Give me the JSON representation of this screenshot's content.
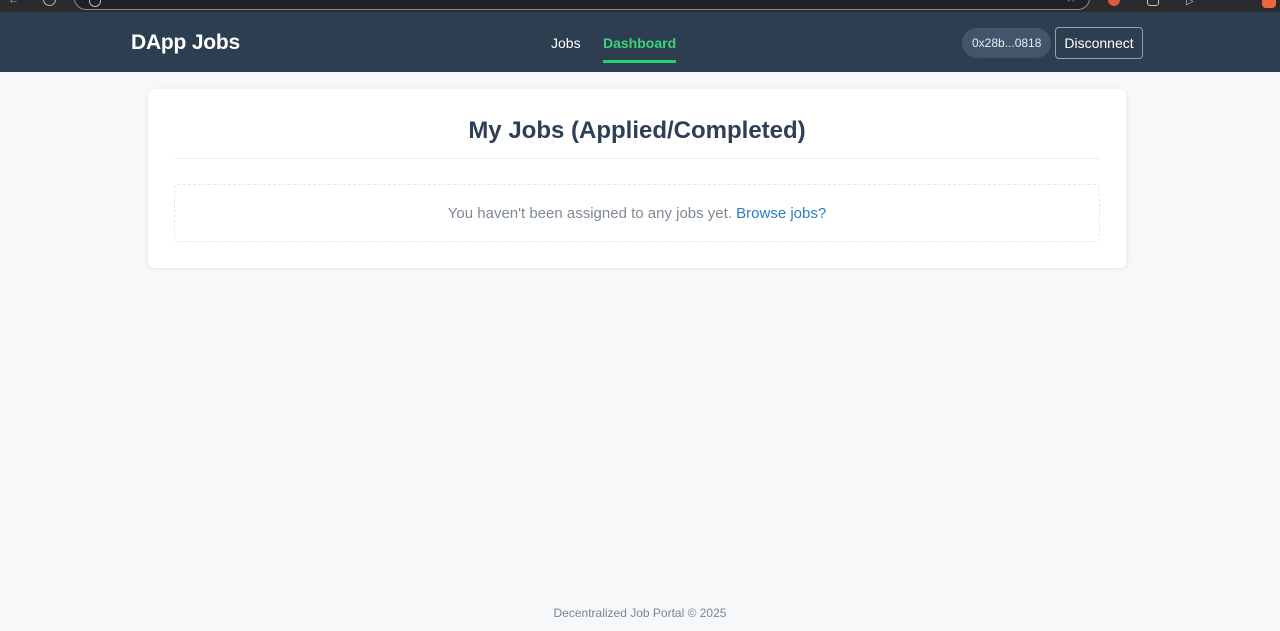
{
  "browser": {
    "icons": [
      "back-icon",
      "reload-icon",
      "info-icon",
      "star-icon",
      "shield-icon",
      "puzzle-icon",
      "play-icon",
      "brave-icon"
    ]
  },
  "header": {
    "brand": "DApp Jobs",
    "nav": [
      {
        "label": "Jobs",
        "active": false
      },
      {
        "label": "Dashboard",
        "active": true
      }
    ],
    "wallet_address": "0x28b...0818",
    "disconnect_label": "Disconnect"
  },
  "main": {
    "title": "My Jobs (Applied/Completed)",
    "empty_message": "You haven't been assigned to any jobs yet.",
    "browse_link": "Browse jobs?"
  },
  "footer": {
    "text": "Decentralized Job Portal © 2025"
  },
  "colors": {
    "header_bg": "#2d3e50",
    "accent_green": "#2ecc71",
    "link_blue": "#2c7cc5",
    "title_text": "#2f4056",
    "page_bg": "#f7f8fa"
  }
}
